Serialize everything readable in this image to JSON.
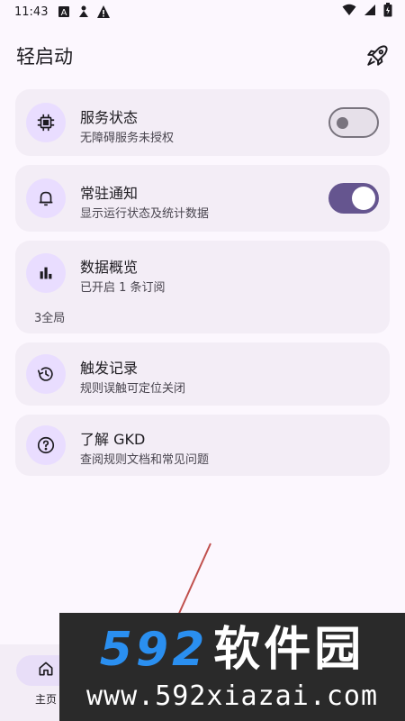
{
  "status_bar": {
    "time": "11:43",
    "icons_left": [
      "notification-a-icon",
      "person-icon",
      "alert-triangle-icon"
    ],
    "icons_right": [
      "wifi-icon",
      "signal-icon",
      "battery-icon"
    ]
  },
  "app_bar": {
    "title": "轻启动",
    "action_icon": "rocket-icon"
  },
  "cards": {
    "service": {
      "title": "服务状态",
      "subtitle": "无障碍服务未授权",
      "icon": "chip-icon",
      "switch_on": false
    },
    "notify": {
      "title": "常驻通知",
      "subtitle": "显示运行状态及统计数据",
      "icon": "bell-icon",
      "switch_on": true
    },
    "data": {
      "title": "数据概览",
      "subtitle": "已开启 1 条订阅",
      "extra": "3全局",
      "icon": "bar-chart-icon"
    },
    "trigger": {
      "title": "触发记录",
      "subtitle": "规则误触可定位关闭",
      "icon": "history-icon"
    },
    "about": {
      "title": "了解 GKD",
      "subtitle": "查阅规则文档和常见问题",
      "icon": "help-icon"
    }
  },
  "bottom_nav": {
    "items": [
      {
        "label": "主页",
        "icon": "home-icon",
        "selected": true
      }
    ]
  },
  "watermark": {
    "number": "592",
    "chinese": "软件园",
    "url": "www.592xiazai.com"
  },
  "colors": {
    "background": "#fcf7fe",
    "card": "#f3edf6",
    "icon_circle": "#e9ddff",
    "accent": "#65558f",
    "watermark_bg": "#2a2a2a",
    "watermark_blue": "#2a8ff0"
  }
}
